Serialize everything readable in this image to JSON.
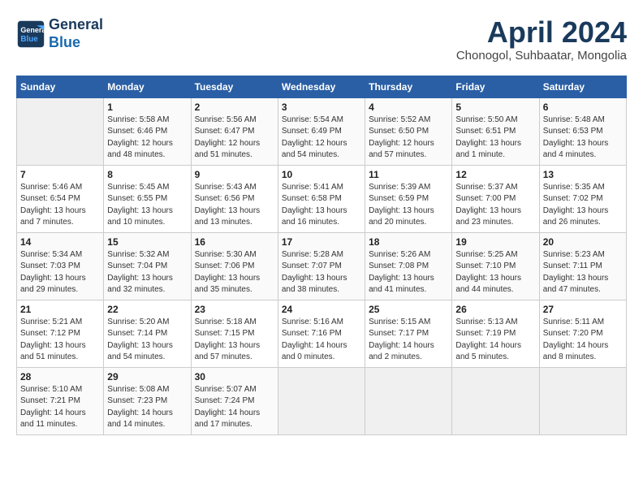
{
  "header": {
    "logo_line1": "General",
    "logo_line2": "Blue",
    "month": "April 2024",
    "location": "Chonogol, Suhbaatar, Mongolia"
  },
  "days_of_week": [
    "Sunday",
    "Monday",
    "Tuesday",
    "Wednesday",
    "Thursday",
    "Friday",
    "Saturday"
  ],
  "weeks": [
    [
      {
        "day": "",
        "info": ""
      },
      {
        "day": "1",
        "info": "Sunrise: 5:58 AM\nSunset: 6:46 PM\nDaylight: 12 hours\nand 48 minutes."
      },
      {
        "day": "2",
        "info": "Sunrise: 5:56 AM\nSunset: 6:47 PM\nDaylight: 12 hours\nand 51 minutes."
      },
      {
        "day": "3",
        "info": "Sunrise: 5:54 AM\nSunset: 6:49 PM\nDaylight: 12 hours\nand 54 minutes."
      },
      {
        "day": "4",
        "info": "Sunrise: 5:52 AM\nSunset: 6:50 PM\nDaylight: 12 hours\nand 57 minutes."
      },
      {
        "day": "5",
        "info": "Sunrise: 5:50 AM\nSunset: 6:51 PM\nDaylight: 13 hours\nand 1 minute."
      },
      {
        "day": "6",
        "info": "Sunrise: 5:48 AM\nSunset: 6:53 PM\nDaylight: 13 hours\nand 4 minutes."
      }
    ],
    [
      {
        "day": "7",
        "info": "Sunrise: 5:46 AM\nSunset: 6:54 PM\nDaylight: 13 hours\nand 7 minutes."
      },
      {
        "day": "8",
        "info": "Sunrise: 5:45 AM\nSunset: 6:55 PM\nDaylight: 13 hours\nand 10 minutes."
      },
      {
        "day": "9",
        "info": "Sunrise: 5:43 AM\nSunset: 6:56 PM\nDaylight: 13 hours\nand 13 minutes."
      },
      {
        "day": "10",
        "info": "Sunrise: 5:41 AM\nSunset: 6:58 PM\nDaylight: 13 hours\nand 16 minutes."
      },
      {
        "day": "11",
        "info": "Sunrise: 5:39 AM\nSunset: 6:59 PM\nDaylight: 13 hours\nand 20 minutes."
      },
      {
        "day": "12",
        "info": "Sunrise: 5:37 AM\nSunset: 7:00 PM\nDaylight: 13 hours\nand 23 minutes."
      },
      {
        "day": "13",
        "info": "Sunrise: 5:35 AM\nSunset: 7:02 PM\nDaylight: 13 hours\nand 26 minutes."
      }
    ],
    [
      {
        "day": "14",
        "info": "Sunrise: 5:34 AM\nSunset: 7:03 PM\nDaylight: 13 hours\nand 29 minutes."
      },
      {
        "day": "15",
        "info": "Sunrise: 5:32 AM\nSunset: 7:04 PM\nDaylight: 13 hours\nand 32 minutes."
      },
      {
        "day": "16",
        "info": "Sunrise: 5:30 AM\nSunset: 7:06 PM\nDaylight: 13 hours\nand 35 minutes."
      },
      {
        "day": "17",
        "info": "Sunrise: 5:28 AM\nSunset: 7:07 PM\nDaylight: 13 hours\nand 38 minutes."
      },
      {
        "day": "18",
        "info": "Sunrise: 5:26 AM\nSunset: 7:08 PM\nDaylight: 13 hours\nand 41 minutes."
      },
      {
        "day": "19",
        "info": "Sunrise: 5:25 AM\nSunset: 7:10 PM\nDaylight: 13 hours\nand 44 minutes."
      },
      {
        "day": "20",
        "info": "Sunrise: 5:23 AM\nSunset: 7:11 PM\nDaylight: 13 hours\nand 47 minutes."
      }
    ],
    [
      {
        "day": "21",
        "info": "Sunrise: 5:21 AM\nSunset: 7:12 PM\nDaylight: 13 hours\nand 51 minutes."
      },
      {
        "day": "22",
        "info": "Sunrise: 5:20 AM\nSunset: 7:14 PM\nDaylight: 13 hours\nand 54 minutes."
      },
      {
        "day": "23",
        "info": "Sunrise: 5:18 AM\nSunset: 7:15 PM\nDaylight: 13 hours\nand 57 minutes."
      },
      {
        "day": "24",
        "info": "Sunrise: 5:16 AM\nSunset: 7:16 PM\nDaylight: 14 hours\nand 0 minutes."
      },
      {
        "day": "25",
        "info": "Sunrise: 5:15 AM\nSunset: 7:17 PM\nDaylight: 14 hours\nand 2 minutes."
      },
      {
        "day": "26",
        "info": "Sunrise: 5:13 AM\nSunset: 7:19 PM\nDaylight: 14 hours\nand 5 minutes."
      },
      {
        "day": "27",
        "info": "Sunrise: 5:11 AM\nSunset: 7:20 PM\nDaylight: 14 hours\nand 8 minutes."
      }
    ],
    [
      {
        "day": "28",
        "info": "Sunrise: 5:10 AM\nSunset: 7:21 PM\nDaylight: 14 hours\nand 11 minutes."
      },
      {
        "day": "29",
        "info": "Sunrise: 5:08 AM\nSunset: 7:23 PM\nDaylight: 14 hours\nand 14 minutes."
      },
      {
        "day": "30",
        "info": "Sunrise: 5:07 AM\nSunset: 7:24 PM\nDaylight: 14 hours\nand 17 minutes."
      },
      {
        "day": "",
        "info": ""
      },
      {
        "day": "",
        "info": ""
      },
      {
        "day": "",
        "info": ""
      },
      {
        "day": "",
        "info": ""
      }
    ]
  ]
}
